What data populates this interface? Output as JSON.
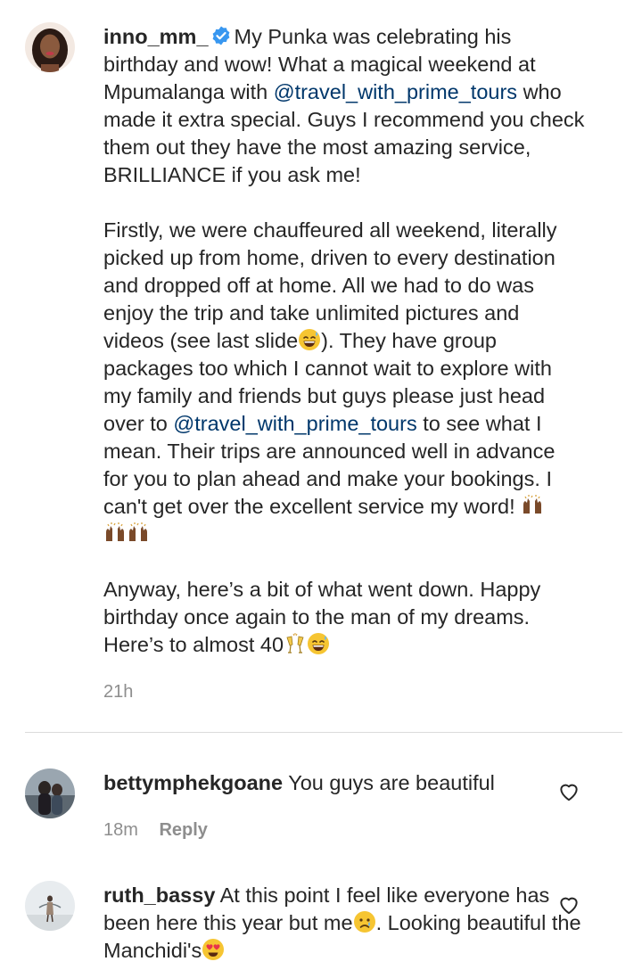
{
  "caption": {
    "username": "inno_mm_",
    "verified": true,
    "text_part1": "My Punka was celebrating his birthday and wow! What a magical weekend at Mpumalanga with ",
    "mention1": "@travel_with_prime_tours",
    "text_part2": " who made it extra special. Guys I recommend you check them out they have the most amazing service, BRILLIANCE if you ask me!",
    "p2_part1": "Firstly, we were chauffeured all weekend, literally picked up from home, driven to every destination and dropped off at home. All we had to do was enjoy the trip and take unlimited pictures and videos (see last slide",
    "p2_part2": "). They have group packages too which I cannot wait to explore with my family and friends but guys please just head over to ",
    "mention2": "@travel_with_prime_tours",
    "p2_part3": " to see what I mean. Their trips are announced well in advance for you to plan ahead and make your bookings. I can't get over the excellent service my word! ",
    "p3_text": "Anyway, here’s a bit of what went down. Happy birthday once again to the man of my dreams. Here’s to almost 40",
    "time": "21h"
  },
  "comments": [
    {
      "username": "bettymphekgoane",
      "text": "You guys are beautiful",
      "time": "18m",
      "reply_label": "Reply"
    },
    {
      "username": "ruth_bassy",
      "text_part1": "At this point I feel like everyone has been here this year but me",
      "text_part2": ". Looking beautiful the Manchidi's"
    }
  ],
  "colors": {
    "text": "#262626",
    "secondary": "#8e8e8e",
    "mention": "#00376b",
    "verified": "#3897f0",
    "divider": "#dbdbdb"
  },
  "icons": [
    "verified-badge-icon",
    "grinning-sweat-emoji",
    "raising-hands-emoji",
    "clinking-glasses-emoji",
    "crying-face-emoji",
    "heart-eyes-emoji",
    "heart-outline-icon"
  ]
}
